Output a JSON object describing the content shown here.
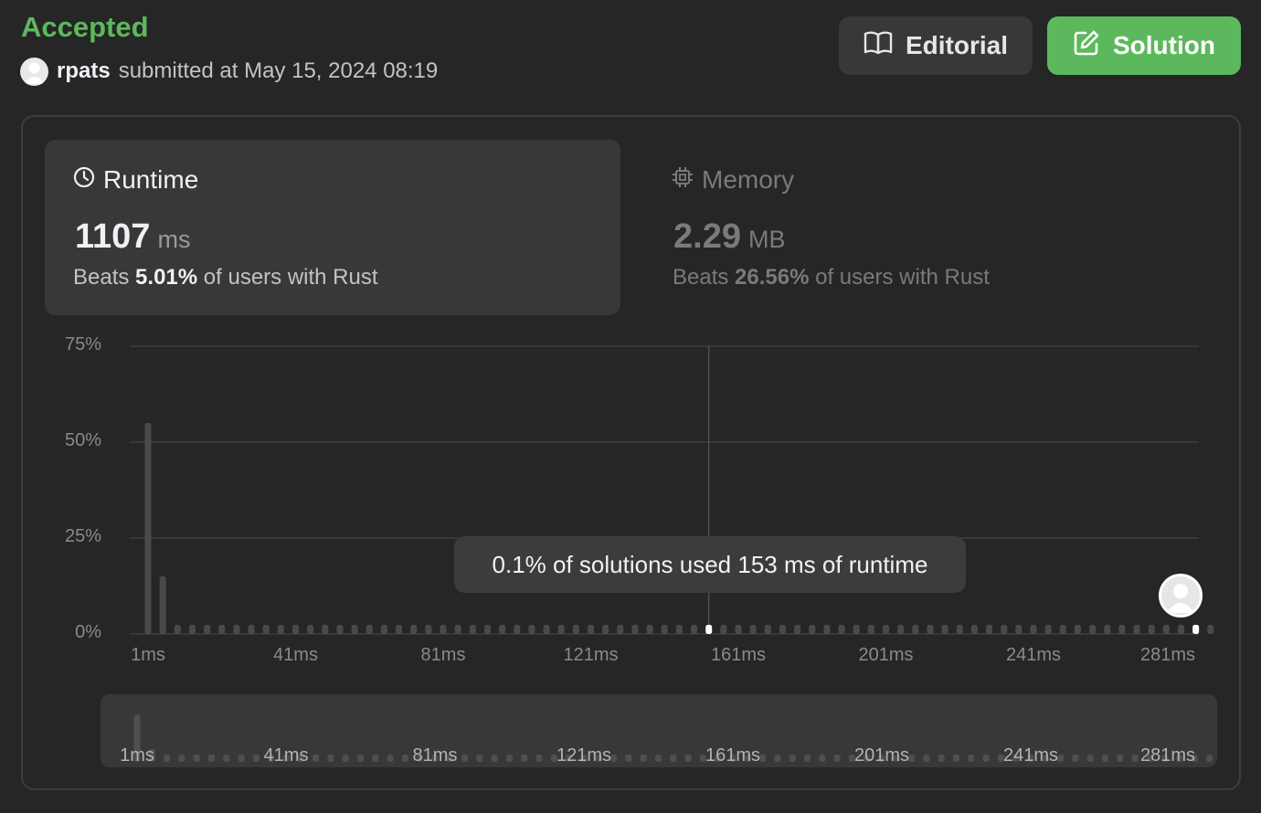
{
  "header": {
    "status": "Accepted",
    "username": "rpats",
    "submitted_text": "submitted at May 15, 2024 08:19",
    "editorial_label": "Editorial",
    "solution_label": "Solution"
  },
  "runtime": {
    "title": "Runtime",
    "value": "1107",
    "unit": "ms",
    "beats_prefix": "Beats",
    "beats_value": "5.01%",
    "beats_suffix": "of users with Rust"
  },
  "memory": {
    "title": "Memory",
    "value": "2.29",
    "unit": "MB",
    "beats_prefix": "Beats",
    "beats_value": "26.56%",
    "beats_suffix": "of users with Rust"
  },
  "tooltip": "0.1% of solutions used 153 ms of runtime",
  "colors": {
    "accent": "#5cb85c",
    "bar": "#4a4a4a",
    "highlight": "#ffffff",
    "text_muted": "#8a8a8a"
  },
  "chart_data": {
    "type": "bar",
    "title": "",
    "xlabel": "",
    "ylabel": "",
    "ylim": [
      0,
      75
    ],
    "y_ticks": [
      "75%",
      "50%",
      "25%",
      "0%"
    ],
    "x_ticks": [
      "1ms",
      "41ms",
      "81ms",
      "121ms",
      "161ms",
      "201ms",
      "241ms",
      "281ms"
    ],
    "x_start_ms": 1,
    "x_step_ms": 4,
    "values": [
      55,
      15,
      0.1,
      0.1,
      0.1,
      0.1,
      0.1,
      0.1,
      0.1,
      0.1,
      0.1,
      0.1,
      0.1,
      0.1,
      0.1,
      0.1,
      0.1,
      0.1,
      0.1,
      0.1,
      0.1,
      0.1,
      0.1,
      0.1,
      0.1,
      0.1,
      0.1,
      0.1,
      0.1,
      0.1,
      0.1,
      0.1,
      0.1,
      0.1,
      0.1,
      0.1,
      0.1,
      0.1,
      0.1,
      0.1,
      0.1,
      0.1,
      0.1,
      0.1,
      0.1,
      0.1,
      0.1,
      0.1,
      0.1,
      0.1,
      0.1,
      0.1,
      0.1,
      0.1,
      0.1,
      0.1,
      0.1,
      0.1,
      0.1,
      0.1,
      0.1,
      0.1,
      0.1,
      0.1,
      0.1,
      0.1,
      0.1,
      0.1,
      0.1,
      0.1,
      0.1,
      0.1,
      0.1
    ],
    "hovered_value_ms": 153,
    "user_value_ms": 285,
    "grid": true
  }
}
